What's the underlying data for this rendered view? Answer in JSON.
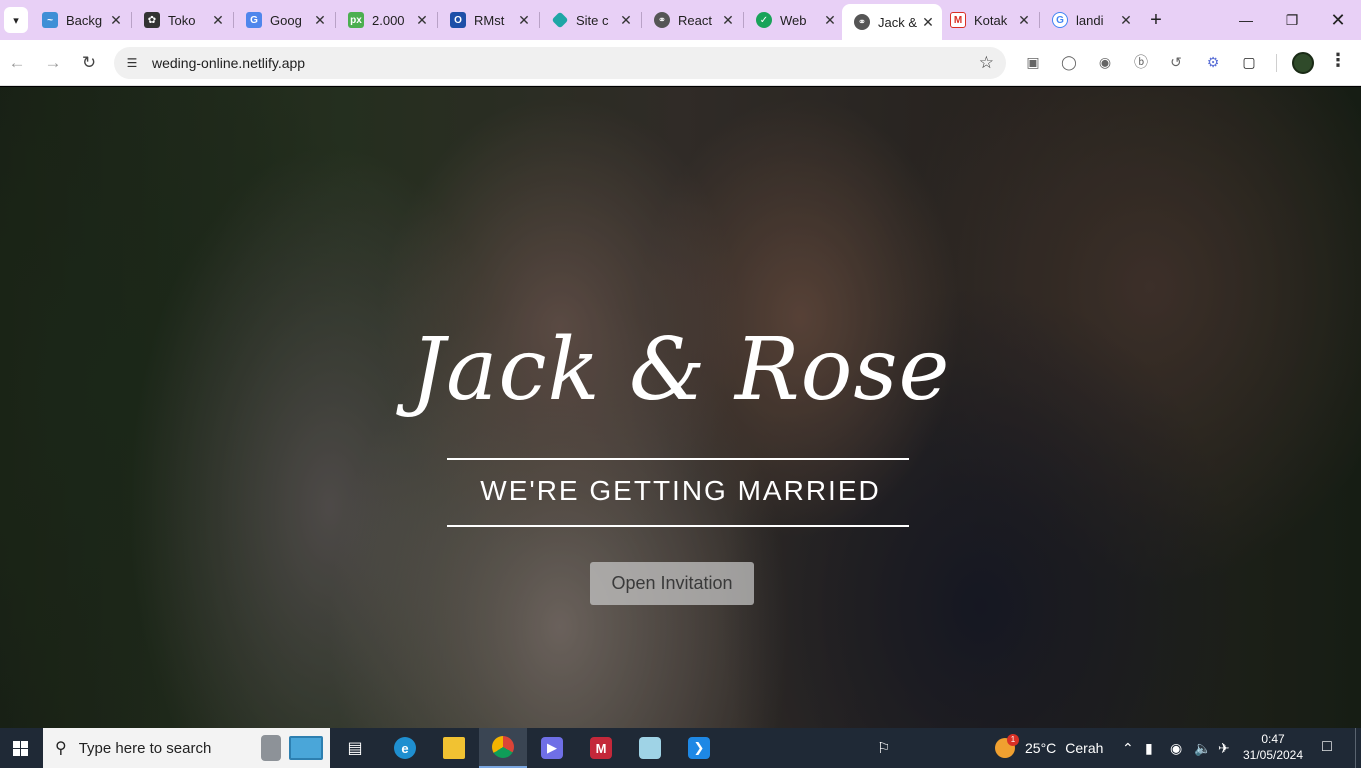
{
  "browser": {
    "tabs": [
      {
        "title": "Backg",
        "favicon": "wave-icon",
        "color": "#3f8fd6",
        "active": false
      },
      {
        "title": "Toko",
        "favicon": "openai-icon",
        "color": "#333333",
        "active": false
      },
      {
        "title": "Goog",
        "favicon": "google-translate-icon",
        "color": "#4f86ec",
        "active": false
      },
      {
        "title": "2.000",
        "favicon": "pexels-icon",
        "color": "#4caf50",
        "active": false
      },
      {
        "title": "RMst",
        "favicon": "outlook-icon",
        "color": "#1e4fa8",
        "active": false
      },
      {
        "title": "Site c",
        "favicon": "diamond-icon",
        "color": "#1ea6a6",
        "active": false
      },
      {
        "title": "React",
        "favicon": "globe-icon",
        "color": "#555555",
        "active": false
      },
      {
        "title": "Web",
        "favicon": "check-circle-icon",
        "color": "#1aa35a",
        "active": false
      },
      {
        "title": "Jack &",
        "favicon": "globe-icon",
        "color": "#555555",
        "active": true
      },
      {
        "title": "Kotak",
        "favicon": "gmail-icon",
        "color": "#d93025",
        "active": false
      },
      {
        "title": "landi",
        "favicon": "google-icon",
        "color": "#4285f4",
        "active": false
      }
    ],
    "url": "weding-online.netlify.app"
  },
  "page": {
    "title": "Jack & Rose",
    "subtitle": "WE'RE GETTING MARRIED",
    "button": "Open Invitation"
  },
  "taskbar": {
    "search_placeholder": "Type here to search",
    "weather": {
      "temp": "25°C",
      "condition": "Cerah",
      "badge": "1"
    },
    "clock": {
      "time": "0:47",
      "date": "31/05/2024"
    }
  }
}
